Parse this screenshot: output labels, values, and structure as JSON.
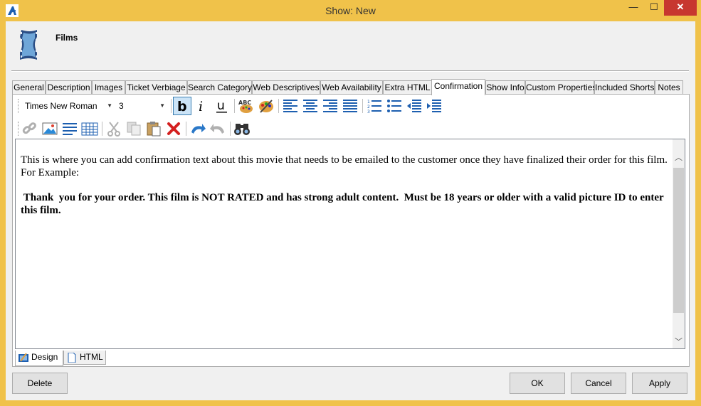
{
  "window": {
    "title": "Show: New",
    "controls": {
      "minimize": "—",
      "maximize": "☐",
      "close": "✕"
    }
  },
  "header": {
    "title": "Films",
    "icon": "film-reel-icon"
  },
  "tabs": [
    {
      "label": "General"
    },
    {
      "label": "Description"
    },
    {
      "label": "Images"
    },
    {
      "label": "Ticket Verbiage"
    },
    {
      "label": "Search Category"
    },
    {
      "label": "Web Descriptives"
    },
    {
      "label": "Web Availability"
    },
    {
      "label": "Extra HTML"
    },
    {
      "label": "Confirmation"
    },
    {
      "label": "Show Info"
    },
    {
      "label": "Custom Properties"
    },
    {
      "label": "Included Shorts"
    },
    {
      "label": "Notes"
    }
  ],
  "active_tab": "Confirmation",
  "toolbar": {
    "font_name": "Times New Roman",
    "font_size": "3",
    "bold_pressed": true
  },
  "editor": {
    "paragraph1": "This is where you can  add confirmation text about this movie that needs to be emailed to the customer once they have finalized their order for this film. For Example:",
    "paragraph2": " Thank  you for your order. This film is NOT RATED and has strong adult content.  Must be 18 years or older with a valid picture ID to enter this film."
  },
  "mode_tabs": {
    "design": "Design",
    "html": "HTML"
  },
  "buttons": {
    "delete": "Delete",
    "ok": "OK",
    "cancel": "Cancel",
    "apply": "Apply"
  },
  "colors": {
    "title_bar": "#f0c24a",
    "close_button": "#c7372f",
    "accent_blue": "#2a6fb6"
  }
}
